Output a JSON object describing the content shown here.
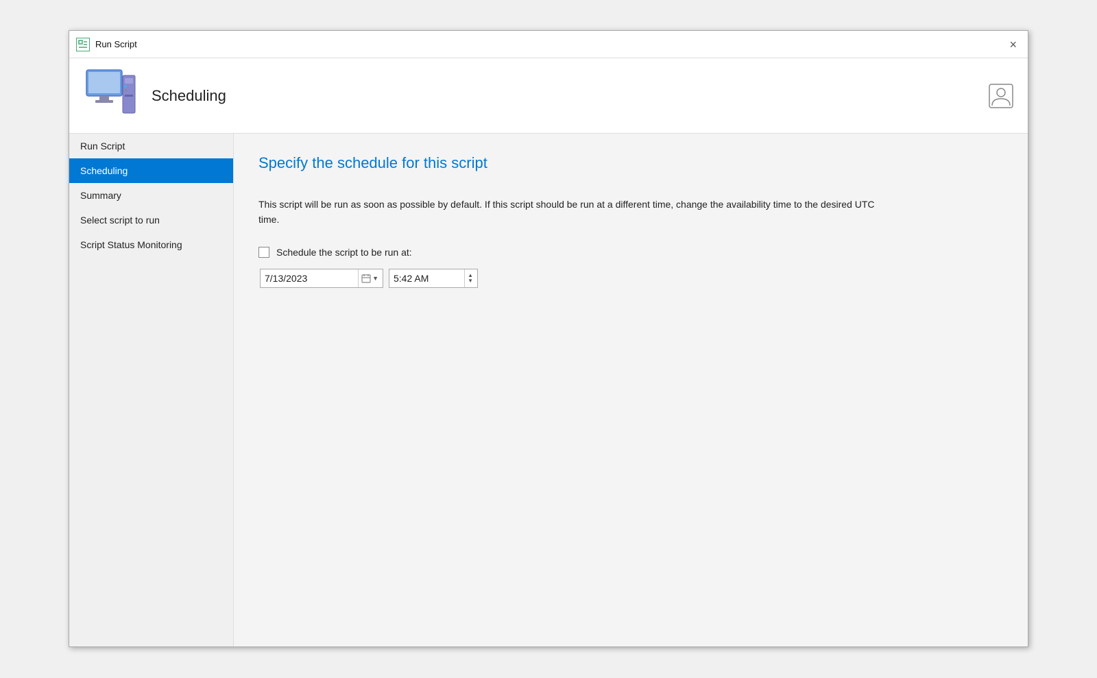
{
  "window": {
    "title": "Run Script",
    "close_label": "×"
  },
  "header": {
    "title": "Scheduling"
  },
  "sidebar": {
    "items": [
      {
        "id": "run-script",
        "label": "Run Script",
        "active": false
      },
      {
        "id": "scheduling",
        "label": "Scheduling",
        "active": true
      },
      {
        "id": "summary",
        "label": "Summary",
        "active": false
      },
      {
        "id": "select-script",
        "label": "Select script to run",
        "active": false
      },
      {
        "id": "script-status",
        "label": "Script Status Monitoring",
        "active": false
      }
    ]
  },
  "main": {
    "title": "Specify the schedule for this script",
    "description": "This script will be run as soon as possible by default. If this script should be run at a different time, change the availability time to the desired UTC time.",
    "checkbox_label": "Schedule the script to be run at:",
    "checkbox_checked": false,
    "date_value": "7/13/2023",
    "time_value": "5:42 AM"
  }
}
